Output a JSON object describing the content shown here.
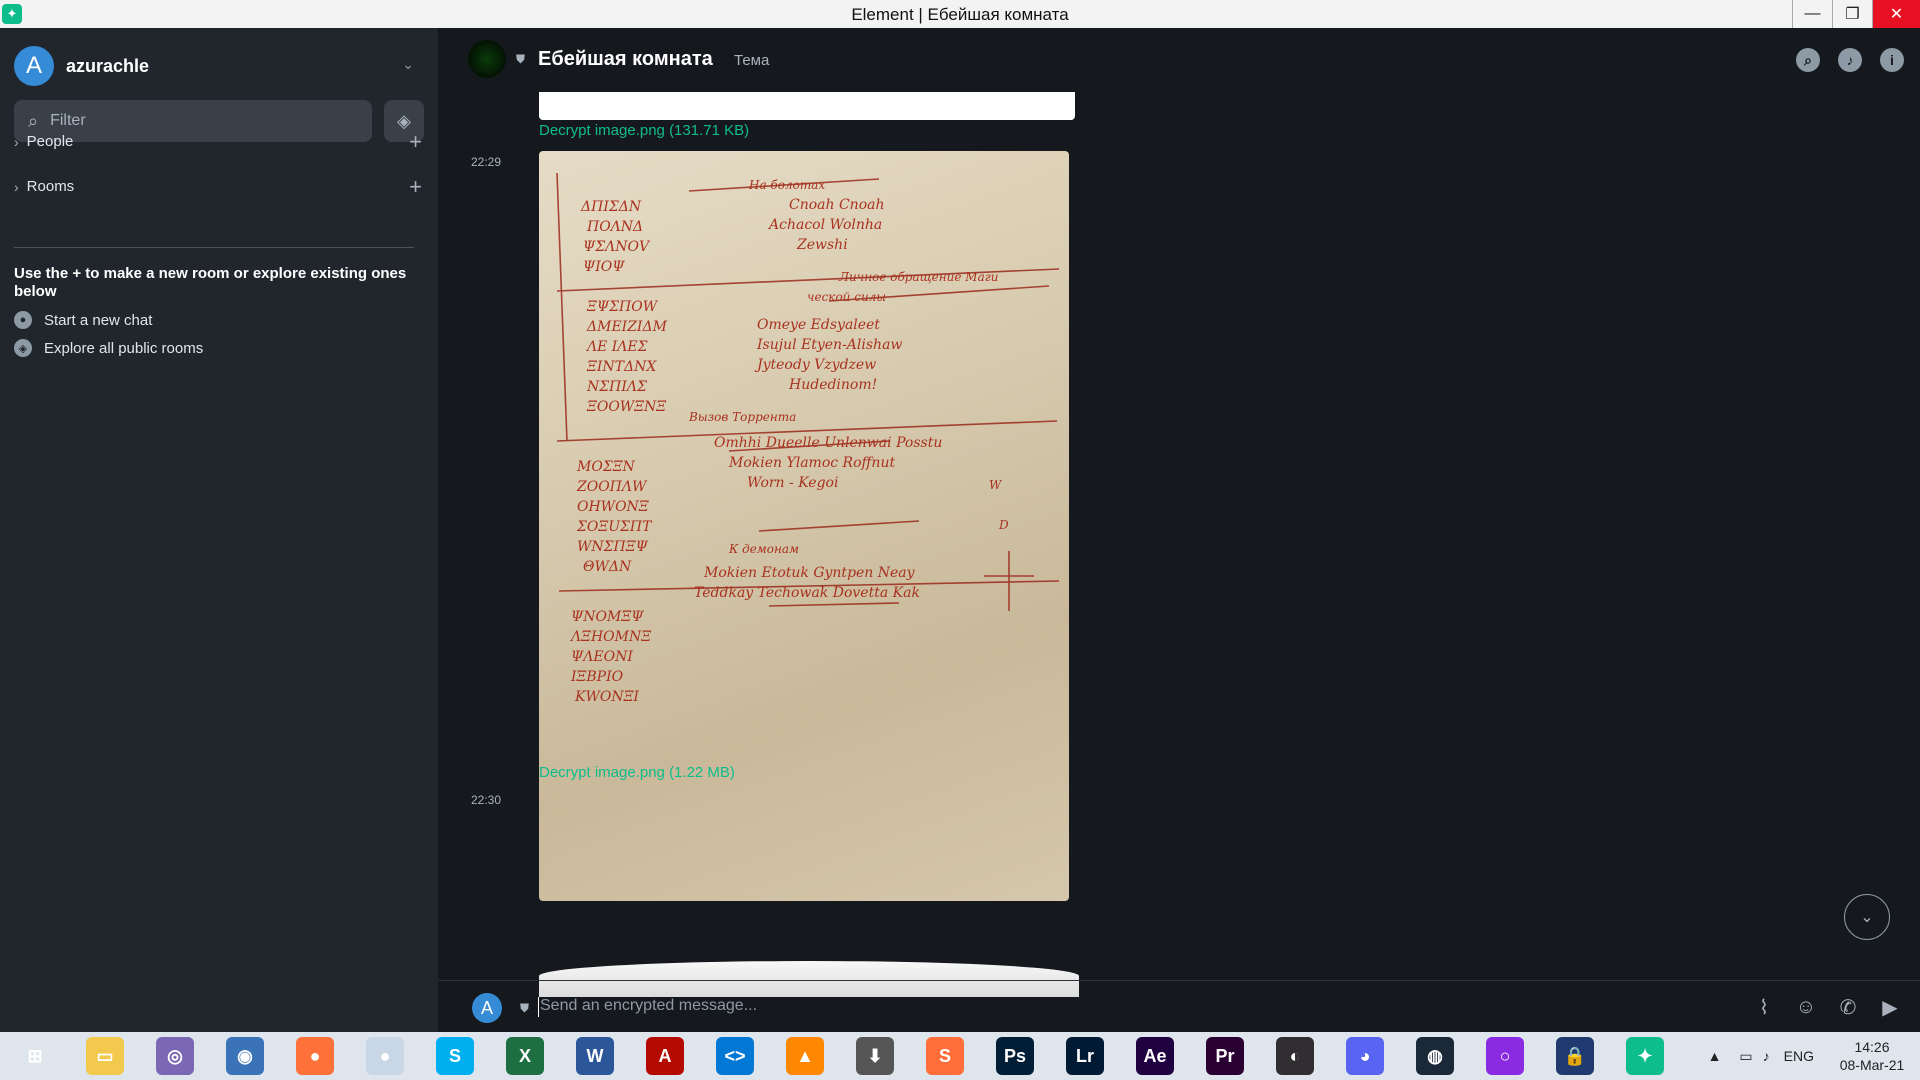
{
  "window": {
    "title": "Element | Ебейшая комната",
    "minimize": "—",
    "restore": "❐",
    "close": "✕"
  },
  "sidebar": {
    "user": {
      "initial": "A",
      "name": "azurachle"
    },
    "filter_placeholder": "Filter",
    "sections": [
      {
        "label": "People"
      },
      {
        "label": "Rooms"
      }
    ],
    "help_text": "Use the + to make a new room or explore existing ones below",
    "links": [
      {
        "label": "Start a new chat"
      },
      {
        "label": "Explore all public rooms"
      }
    ]
  },
  "room": {
    "name": "Ебейшая комната",
    "topic": "Тема"
  },
  "timeline": {
    "file1": "Decrypt image.png (131.71 KB)",
    "time1": "22:29",
    "file2": "Decrypt image.png (1.22 MB)",
    "time2": "22:30"
  },
  "composer": {
    "initial": "A",
    "placeholder": "Send an encrypted message..."
  },
  "taskbar": {
    "apps": [
      {
        "name": "start",
        "label": "⊞",
        "color": "#dfe5ec"
      },
      {
        "name": "file-explorer",
        "label": "▭",
        "color": "#f2c94c"
      },
      {
        "name": "qbittorrent",
        "label": "◎",
        "color": "#7b68b5"
      },
      {
        "name": "browser",
        "label": "◉",
        "color": "#3b73b9"
      },
      {
        "name": "firefox",
        "label": "●",
        "color": "#ff7139"
      },
      {
        "name": "moon-app",
        "label": "●",
        "color": "#c8d6e5"
      },
      {
        "name": "skype",
        "label": "S",
        "color": "#00aff0"
      },
      {
        "name": "excel",
        "label": "X",
        "color": "#1d6f42"
      },
      {
        "name": "word",
        "label": "W",
        "color": "#2b579a"
      },
      {
        "name": "acrobat",
        "label": "A",
        "color": "#b30b00"
      },
      {
        "name": "vscode",
        "label": "<>",
        "color": "#0078d4"
      },
      {
        "name": "vlc",
        "label": "▲",
        "color": "#ff8800"
      },
      {
        "name": "downloader",
        "label": "⬇",
        "color": "#555555"
      },
      {
        "name": "sublime",
        "label": "S",
        "color": "#ff6d3a"
      },
      {
        "name": "photoshop",
        "label": "Ps",
        "color": "#001e36"
      },
      {
        "name": "lightroom",
        "label": "Lr",
        "color": "#001a33"
      },
      {
        "name": "after-effects",
        "label": "Ae",
        "color": "#1f0040"
      },
      {
        "name": "premiere",
        "label": "Pr",
        "color": "#2a0033"
      },
      {
        "name": "obs",
        "label": "◐",
        "color": "#302e31"
      },
      {
        "name": "discord",
        "label": "◕",
        "color": "#5865f2"
      },
      {
        "name": "steam",
        "label": "◍",
        "color": "#1b2838"
      },
      {
        "name": "circle-app",
        "label": "○",
        "color": "#8a2be2"
      },
      {
        "name": "vpn",
        "label": "🔒",
        "color": "#1e3a6e"
      },
      {
        "name": "element",
        "label": "✦",
        "color": "#0dbd8b"
      }
    ],
    "lang": "ENG",
    "time": "14:26",
    "date": "08-Mar-21"
  }
}
